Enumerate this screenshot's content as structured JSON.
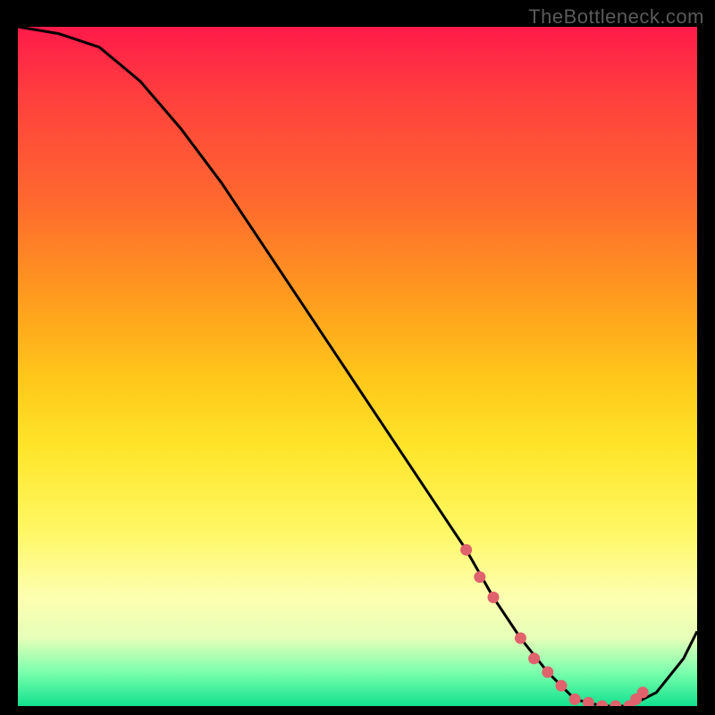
{
  "watermark": "TheBottleneck.com",
  "chart_data": {
    "type": "line",
    "title": "",
    "xlabel": "",
    "ylabel": "",
    "xlim": [
      0,
      100
    ],
    "ylim": [
      0,
      100
    ],
    "series": [
      {
        "name": "bottleneck-curve",
        "x": [
          0,
          6,
          12,
          18,
          24,
          30,
          36,
          42,
          48,
          54,
          60,
          66,
          70,
          74,
          78,
          82,
          86,
          90,
          94,
          98,
          100
        ],
        "values": [
          100,
          99,
          97,
          92,
          85,
          77,
          68,
          59,
          50,
          41,
          32,
          23,
          16,
          10,
          5,
          1,
          0,
          0,
          2,
          7,
          11
        ]
      }
    ],
    "markers": {
      "name": "trough-markers",
      "x": [
        66,
        68,
        70,
        74,
        76,
        78,
        80,
        82,
        84,
        86,
        88,
        90,
        91,
        92
      ],
      "values": [
        23,
        19,
        16,
        10,
        7,
        5,
        3,
        1,
        0.5,
        0,
        0,
        0,
        1,
        2
      ]
    },
    "gradient_stops": [
      {
        "pos": 0,
        "color": "#ff1a4a"
      },
      {
        "pos": 10,
        "color": "#ff3e3e"
      },
      {
        "pos": 26,
        "color": "#ff6a2e"
      },
      {
        "pos": 40,
        "color": "#ff9c1e"
      },
      {
        "pos": 52,
        "color": "#ffc81a"
      },
      {
        "pos": 62,
        "color": "#ffe52a"
      },
      {
        "pos": 74,
        "color": "#fff763"
      },
      {
        "pos": 84,
        "color": "#fdffb0"
      },
      {
        "pos": 90,
        "color": "#e6ffb8"
      },
      {
        "pos": 95,
        "color": "#7bffad"
      },
      {
        "pos": 100,
        "color": "#12e18e"
      }
    ]
  },
  "colors": {
    "curve_stroke": "#000000",
    "marker_fill": "#e0626c",
    "background": "#000000"
  }
}
